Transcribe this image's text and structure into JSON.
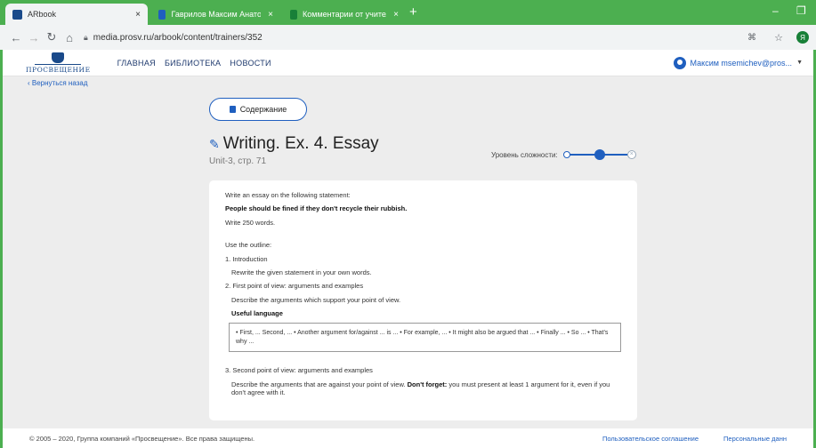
{
  "browser": {
    "tabs": [
      {
        "label": "АRbook",
        "active": true,
        "color": "#1a4a8a"
      },
      {
        "label": "Гаврилов Максим Анатольевич",
        "active": false,
        "color": "#1f5fbf"
      },
      {
        "label": "Комментарии от учителей - Go",
        "active": false,
        "color": "#188038"
      }
    ],
    "new_tab": "+",
    "close": "×",
    "minimize": "–",
    "restore": "❐",
    "url": "media.prosv.ru/arbook/content/trainers/352",
    "profile_initial": "Я"
  },
  "header": {
    "logo_text": "ПРОСВЕЩЕНИЕ",
    "nav": [
      "ГЛАВНАЯ",
      "БИБЛИОТЕКА",
      "НОВОСТИ"
    ],
    "user": "Максим msemichev@pros..."
  },
  "back_link": "‹  Вернуться назад",
  "contents_button": "Содержание",
  "exercise": {
    "title": "Writing. Ex. 4. Essay",
    "subtitle": "Unit-3, стр. 71",
    "level_label": "Уровень сложности:",
    "level": 0.5
  },
  "content": {
    "intro": "Write an essay on the following statement:",
    "statement": "People should be fined if they don't recycle their rubbish.",
    "words": "Write 250 words.",
    "outline_label": "Use the outline:",
    "item1": "1. Introduction",
    "item1_desc": "Rewrite the given statement in your own words.",
    "item2": "2. First point of view: arguments and examples",
    "item2_desc": "Describe the arguments which support your point of view.",
    "useful_label": "Useful language",
    "useful_text": "• First, ... Second, ... • Another argument for/against ... is ... • For example, ... • It might also be argued that ... • Finally ... • So ... • That's why ...",
    "item3": "3. Second point of view: arguments and examples",
    "item3_desc_a": "Describe the arguments that are against your point of view. ",
    "item3_dont": "Don't forget:",
    "item3_desc_b": " you must present at least 1    argument for it, even if you don't agree with it."
  },
  "footer": {
    "copyright": "© 2005 – 2020, Группа компаний «Просвещение». Все права защищены.",
    "links": [
      "Пользовательское соглашение",
      "Персональные данн"
    ]
  }
}
